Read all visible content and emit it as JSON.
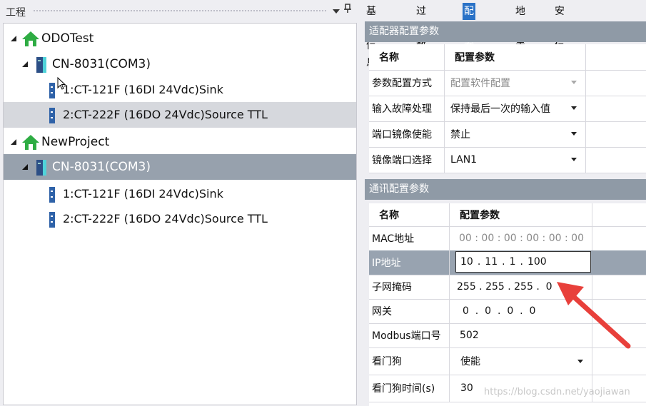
{
  "left_panel": {
    "title": "工程",
    "pin_glyph": "ꟷ",
    "tree": [
      {
        "label": "ODOTest",
        "level": 0,
        "icon": "house-icon"
      },
      {
        "label": "CN-8031(COM3)",
        "level": 1,
        "icon": "adapter-icon"
      },
      {
        "label": "1:CT-121F (16DI 24Vdc)Sink",
        "level": 2,
        "icon": "module-icon"
      },
      {
        "label": "2:CT-222F (16DO 24Vdc)Source TTL",
        "level": 2,
        "icon": "module-icon",
        "selected": "light"
      },
      {
        "label": "NewProject",
        "level": 0,
        "icon": "house-icon"
      },
      {
        "label": "CN-8031(COM3)",
        "level": 1,
        "icon": "adapter-icon",
        "selected": "dark"
      },
      {
        "label": "1:CT-121F (16DI 24Vdc)Sink",
        "level": 2,
        "icon": "module-icon"
      },
      {
        "label": "2:CT-222F (16DO 24Vdc)Source TTL",
        "level": 2,
        "icon": "module-icon"
      }
    ]
  },
  "right_panel": {
    "tabs": [
      {
        "label": "基本信息",
        "active": false
      },
      {
        "label": "过程数据",
        "active": false
      },
      {
        "label": "配置参数",
        "active": true
      },
      {
        "label": "地址表",
        "active": false
      },
      {
        "label": "安装信息",
        "active": false
      }
    ],
    "adapter_section": {
      "title": "适配器配置参数",
      "header": {
        "name": "名称",
        "param": "配置参数"
      },
      "rows": [
        {
          "name": "参数配置方式",
          "value": "配置软件配置",
          "dropdown": true,
          "disabled": true
        },
        {
          "name": "输入故障处理",
          "value": "保持最后一次的输入值",
          "dropdown": true
        },
        {
          "name": "端口镜像使能",
          "value": "禁止",
          "dropdown": true
        },
        {
          "name": "镜像端口选择",
          "value": "LAN1",
          "dropdown": true
        }
      ]
    },
    "comm_section": {
      "title": "通讯配置参数",
      "header": {
        "name": "名称",
        "param": "配置参数"
      },
      "mac": {
        "name": "MAC地址",
        "value": "00 : 00 : 00 : 00 : 00 : 00"
      },
      "ip": {
        "name": "IP地址",
        "octets": [
          "10",
          "11",
          "1",
          "100"
        ]
      },
      "mask": {
        "name": "子网掩码",
        "value": "255 . 255 . 255 .  0"
      },
      "gateway": {
        "name": "网关",
        "value": "0  .  0  .  0  .  0"
      },
      "modbus": {
        "name": "Modbus端口号",
        "value": "502"
      },
      "watchdog": {
        "name": "看门狗",
        "value": "使能"
      },
      "watchdog_time": {
        "name": "看门狗时间(s)",
        "value": "30"
      }
    }
  },
  "watermark": "https://blog.csdn.net/yaojiawan",
  "colors": {
    "accent": "#2a72c7",
    "arrow": "#e8403b",
    "house": "#2eac43"
  }
}
